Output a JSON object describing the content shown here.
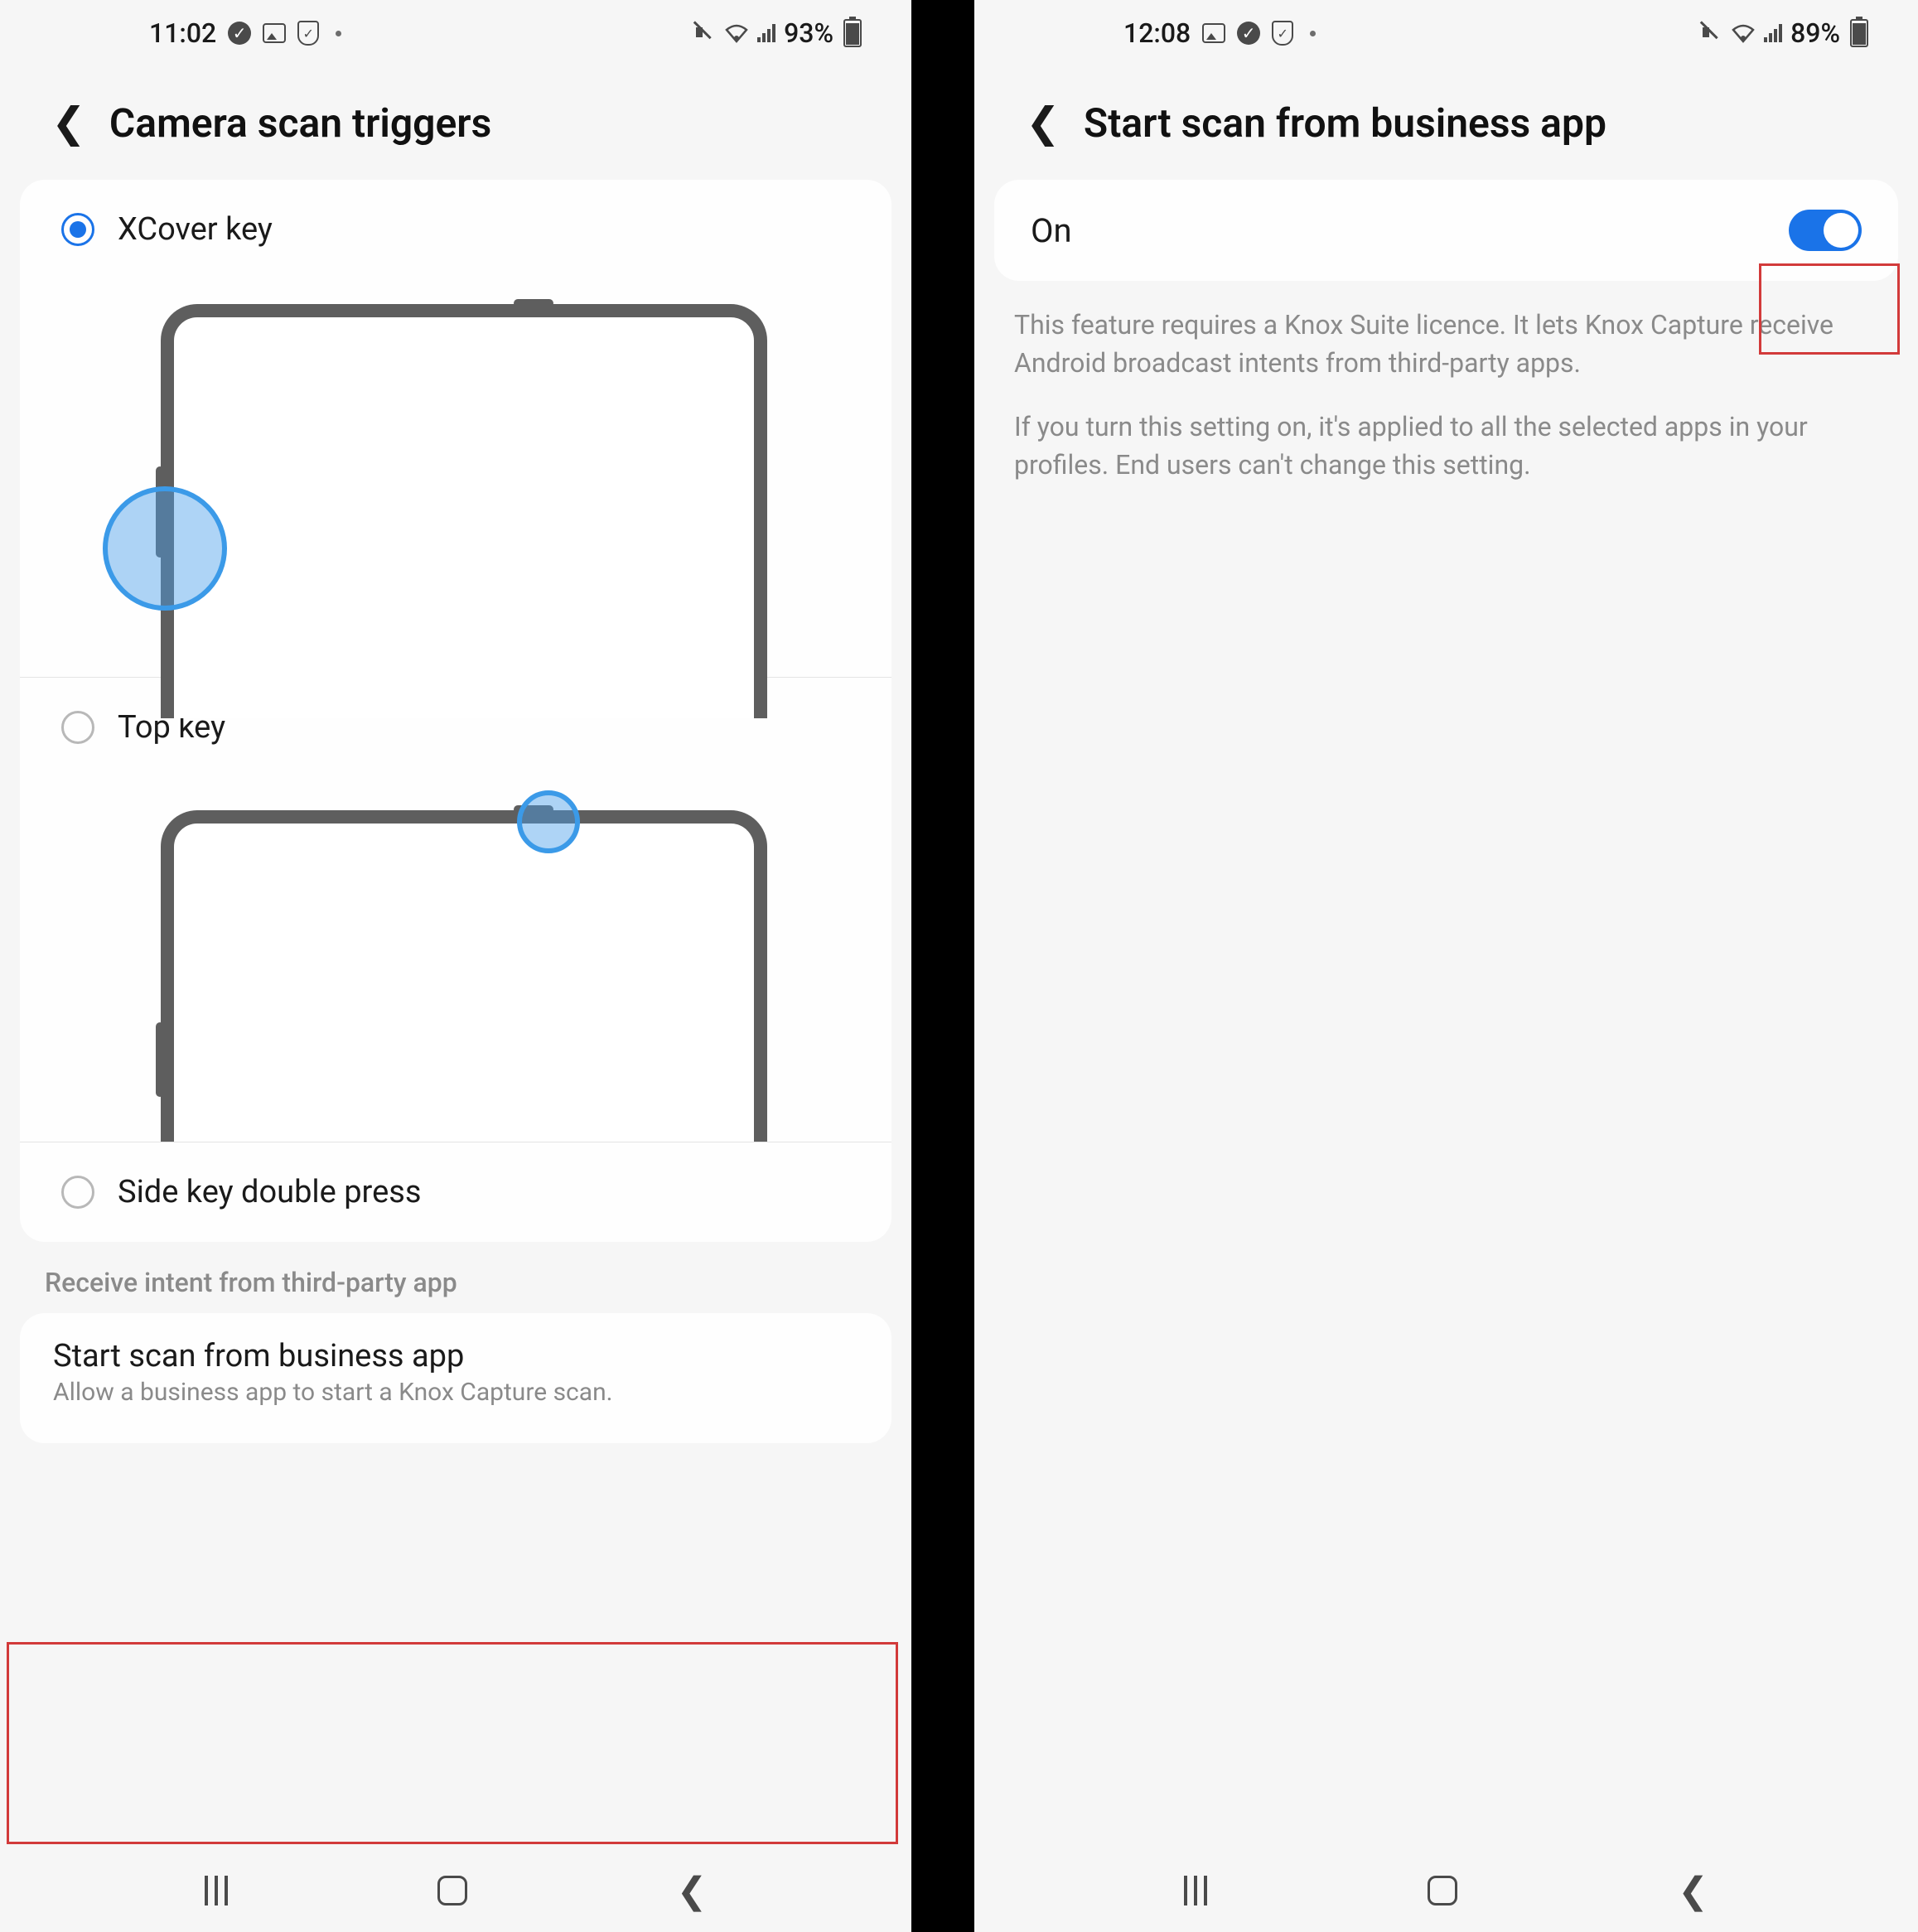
{
  "left": {
    "status": {
      "time": "11:02",
      "battery": "93%"
    },
    "title": "Camera scan triggers",
    "options": [
      {
        "label": "XCover key",
        "selected": true
      },
      {
        "label": "Top key",
        "selected": false
      },
      {
        "label": "Side key double press",
        "selected": false
      }
    ],
    "section_label": "Receive intent from third-party app",
    "item": {
      "title": "Start scan from business app",
      "subtitle": "Allow a business app to start a Knox Capture scan."
    }
  },
  "right": {
    "status": {
      "time": "12:08",
      "battery": "89%"
    },
    "title": "Start scan from business app",
    "toggle_label": "On",
    "toggle_on": true,
    "info1": "This feature requires a Knox Suite licence. It lets Knox Capture receive Android broadcast intents from third-party apps.",
    "info2": "If you turn this setting on, it's applied to all the selected apps in your profiles. End users can't change this setting."
  }
}
